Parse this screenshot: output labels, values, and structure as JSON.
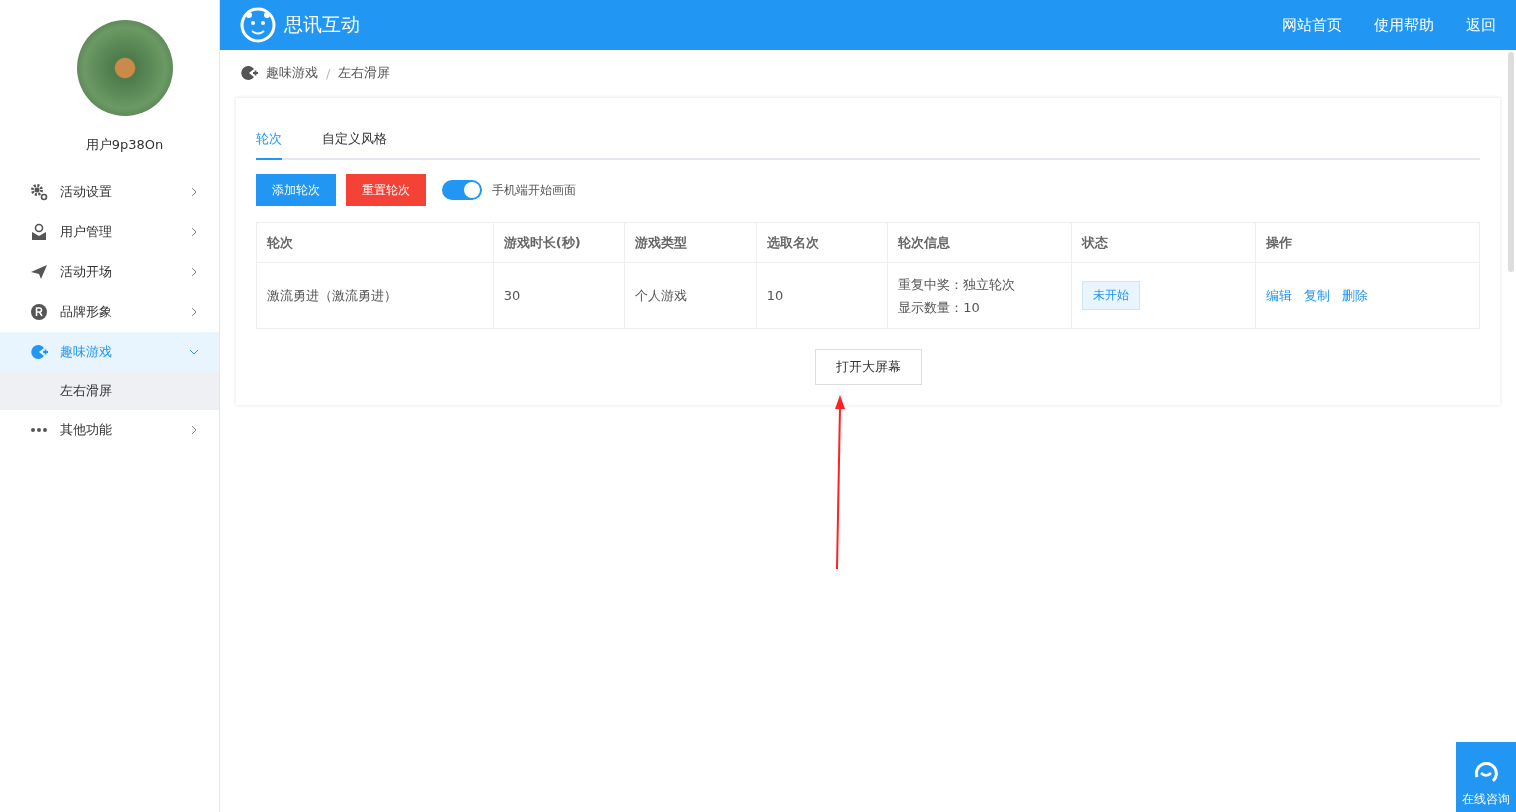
{
  "sidebar": {
    "username": "用户9p38On",
    "items": [
      {
        "label": "活动设置",
        "expanded": false,
        "selected": false
      },
      {
        "label": "用户管理",
        "expanded": false,
        "selected": false
      },
      {
        "label": "活动开场",
        "expanded": false,
        "selected": false
      },
      {
        "label": "品牌形象",
        "expanded": false,
        "selected": false
      },
      {
        "label": "趣味游戏",
        "expanded": true,
        "selected": true,
        "children": [
          {
            "label": "左右滑屏",
            "selected": true
          }
        ]
      },
      {
        "label": "其他功能",
        "expanded": false,
        "selected": false
      }
    ]
  },
  "header": {
    "brand": "思讯互动",
    "links": [
      "网站首页",
      "使用帮助",
      "返回"
    ]
  },
  "breadcrumb": [
    "趣味游戏",
    "左右滑屏"
  ],
  "breadcrumb_separator": "/",
  "tabs": [
    {
      "label": "轮次",
      "selected": true
    },
    {
      "label": "自定义风格",
      "selected": false
    }
  ],
  "toolbar": {
    "buttons": [
      {
        "label": "添加轮次",
        "kind": "primary"
      },
      {
        "label": "重置轮次",
        "kind": "danger"
      }
    ],
    "toggle": {
      "label": "手机端开始画面",
      "on": true
    }
  },
  "table": {
    "columns": [
      "轮次",
      "游戏时长(秒)",
      "游戏类型",
      "选取名次",
      "轮次信息",
      "状态",
      "操作"
    ],
    "rows": [
      {
        "name": "激流勇进（激流勇进）",
        "duration": "30",
        "type": "个人游戏",
        "rank": "10",
        "info": [
          "重复中奖：独立轮次",
          "显示数量：10"
        ],
        "status": "未开始",
        "actions": [
          "编辑",
          "复制",
          "删除"
        ]
      }
    ]
  },
  "open_button": "打开大屏幕",
  "consult": "在线咨询"
}
